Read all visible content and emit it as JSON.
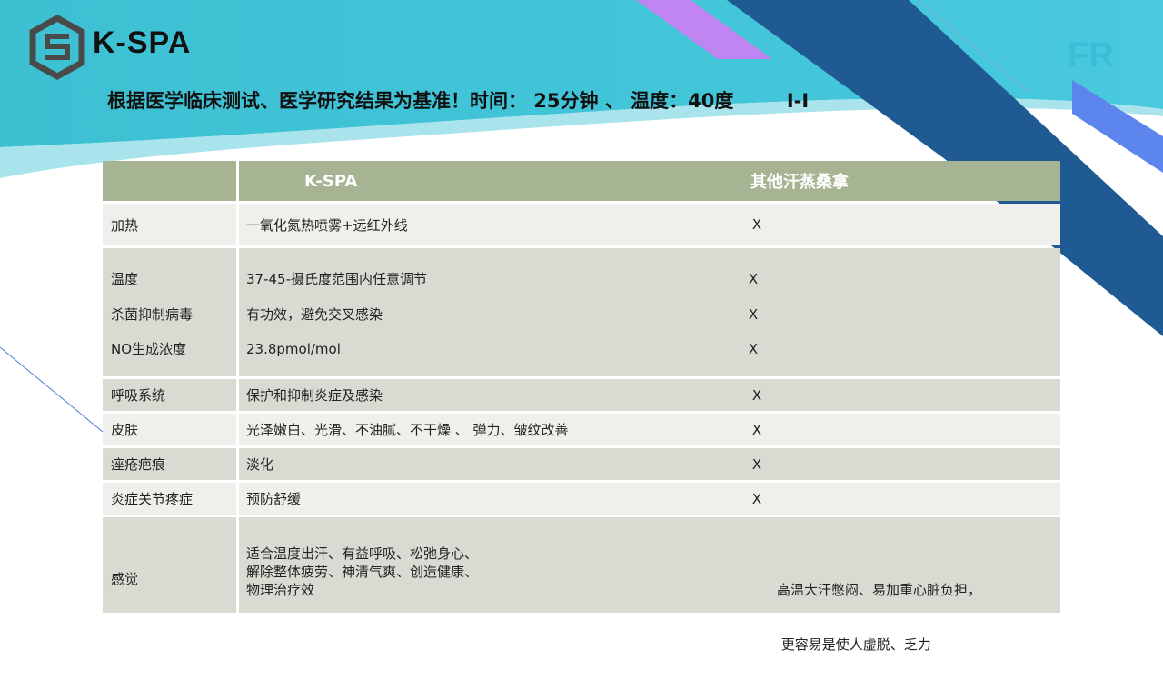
{
  "header": {
    "brand": "K-SPA",
    "corner_text": "FR",
    "headline": "根据医学临床测试、医学研究结果为基准！时间： 25分钟 、 温度：40度        I-I"
  },
  "colors": {
    "teal": "#3dc3d6",
    "navy": "#1f5a93",
    "purple": "#c185f2",
    "header_green": "#a7b493",
    "row_dark": "#d9dbd3",
    "row_light": "#eff0ec"
  },
  "icons": {
    "logo": "k-spa-hexagon-logo"
  },
  "table": {
    "headers": [
      "",
      "K-SPA",
      "其他汗蒸桑拿"
    ],
    "rows": {
      "heating": {
        "label": "加热",
        "kspa": "一氧化氮热喷雾+远红外线",
        "other": "X"
      },
      "group": [
        {
          "label": "温度",
          "kspa": "37-45-摄氏度范围内任意调节",
          "other": "X"
        },
        {
          "label": "杀菌抑制病毒",
          "kspa": "有功效，避免交叉感染",
          "other": "X"
        },
        {
          "label": "NO生成浓度",
          "kspa": "23.8pmol/mol",
          "other": "X"
        }
      ],
      "respiratory": {
        "label": "呼吸系统",
        "kspa": "保护和抑制炎症及感染",
        "other": "X"
      },
      "skin": {
        "label": "皮肤",
        "kspa": "光泽嫩白、光滑、不油腻、不干燥 、 弹力、皱纹改善",
        "other": "X"
      },
      "acne": {
        "label": "痤疮疤痕",
        "kspa": "淡化",
        "other": "X"
      },
      "joint": {
        "label": "炎症关节疼症",
        "kspa": "预防舒缓",
        "other": "X"
      },
      "feeling": {
        "label": "感觉",
        "kspa_lines": [
          "适合温度出汗、有益呼吸、松弛身心、",
          "解除整体疲劳、神清气爽、创造健康、",
          "物理治疗效"
        ],
        "other_lines": [
          "高温大汗憋闷、易加重心脏负担，",
          " 更容易是使人虚脱、乏力"
        ]
      }
    }
  }
}
